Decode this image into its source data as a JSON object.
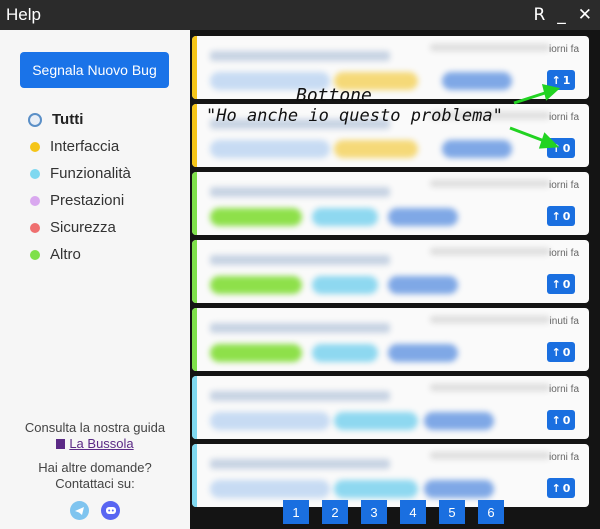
{
  "window": {
    "title": "Help",
    "controls": {
      "restore": "R",
      "minimize": "_",
      "close": "✕"
    }
  },
  "sidebar": {
    "new_bug_label": "Segnala Nuovo Bug",
    "categories": [
      {
        "label": "Tutti",
        "color": "#5a8fc7",
        "active": true
      },
      {
        "label": "Interfaccia",
        "color": "#f5c518"
      },
      {
        "label": "Funzionalità",
        "color": "#7fd8f0"
      },
      {
        "label": "Prestazioni",
        "color": "#d9a8ef"
      },
      {
        "label": "Sicurezza",
        "color": "#ef6f6f"
      },
      {
        "label": "Altro",
        "color": "#7ee04a"
      }
    ],
    "guide_text": "Consulta la nostra guida",
    "guide_link": "La Bussola",
    "contact_line1": "Hai altre domande?",
    "contact_line2": "Contattaci su:",
    "social": [
      "telegram-icon",
      "discord-icon"
    ]
  },
  "issues": [
    {
      "time": "iorni fa",
      "votes": "1",
      "accent": "#f5c518"
    },
    {
      "time": "iorni fa",
      "votes": "0",
      "accent": "#f5c518"
    },
    {
      "time": "iorni fa",
      "votes": "0",
      "accent": "#7ee04a"
    },
    {
      "time": "iorni fa",
      "votes": "0",
      "accent": "#7ee04a"
    },
    {
      "time": "inuti fa",
      "votes": "0",
      "accent": "#7ee04a"
    },
    {
      "time": "iorni fa",
      "votes": "0",
      "accent": "#7fd8f0"
    },
    {
      "time": "iorni fa",
      "votes": "0",
      "accent": "#7fd8f0"
    }
  ],
  "pagination": [
    "1",
    "2",
    "3",
    "4",
    "5",
    "6"
  ],
  "annotation": {
    "line1": "Bottone",
    "line2": "\"Ho anche io questo problema\""
  },
  "colors": {
    "accent": "#1a73e8",
    "titlebar": "#2b2b2b",
    "sidebar": "#f6f6f6"
  }
}
